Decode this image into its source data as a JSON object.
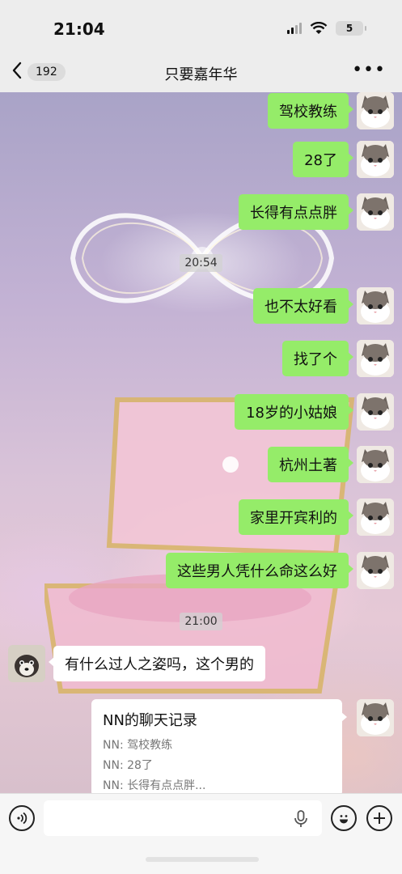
{
  "status_bar": {
    "time": "21:04",
    "battery": "5"
  },
  "nav": {
    "unread_count": "192",
    "title": "只要嘉年华",
    "more": "•••"
  },
  "messages": [
    {
      "text": "驾校教练"
    },
    {
      "text": "28了"
    },
    {
      "text": "长得有点点胖"
    },
    {
      "text": "也不太好看"
    },
    {
      "text": "找了个"
    },
    {
      "text": "18岁的小姑娘"
    },
    {
      "text": "杭州土著"
    },
    {
      "text": "家里开宾利的"
    },
    {
      "text": "这些男人凭什么命这么好"
    }
  ],
  "timestamps": [
    "20:54",
    "21:00"
  ],
  "incoming": {
    "text": "有什么过人之姿吗，这个男的"
  },
  "forward_card": {
    "title": "NN的聊天记录",
    "lines": [
      "NN: 驾校教练",
      "NN: 28了",
      "NN: 长得有点点胖..."
    ]
  },
  "colors": {
    "outgoing_bubble": "#95ec69",
    "incoming_bubble": "#ffffff",
    "nav_bg": "#ededed"
  },
  "icons": [
    "back-chevron-icon",
    "more-icon",
    "cat-avatar-icon",
    "dog-avatar-icon",
    "voice-icon",
    "mic-icon",
    "emoji-icon",
    "plus-icon"
  ]
}
